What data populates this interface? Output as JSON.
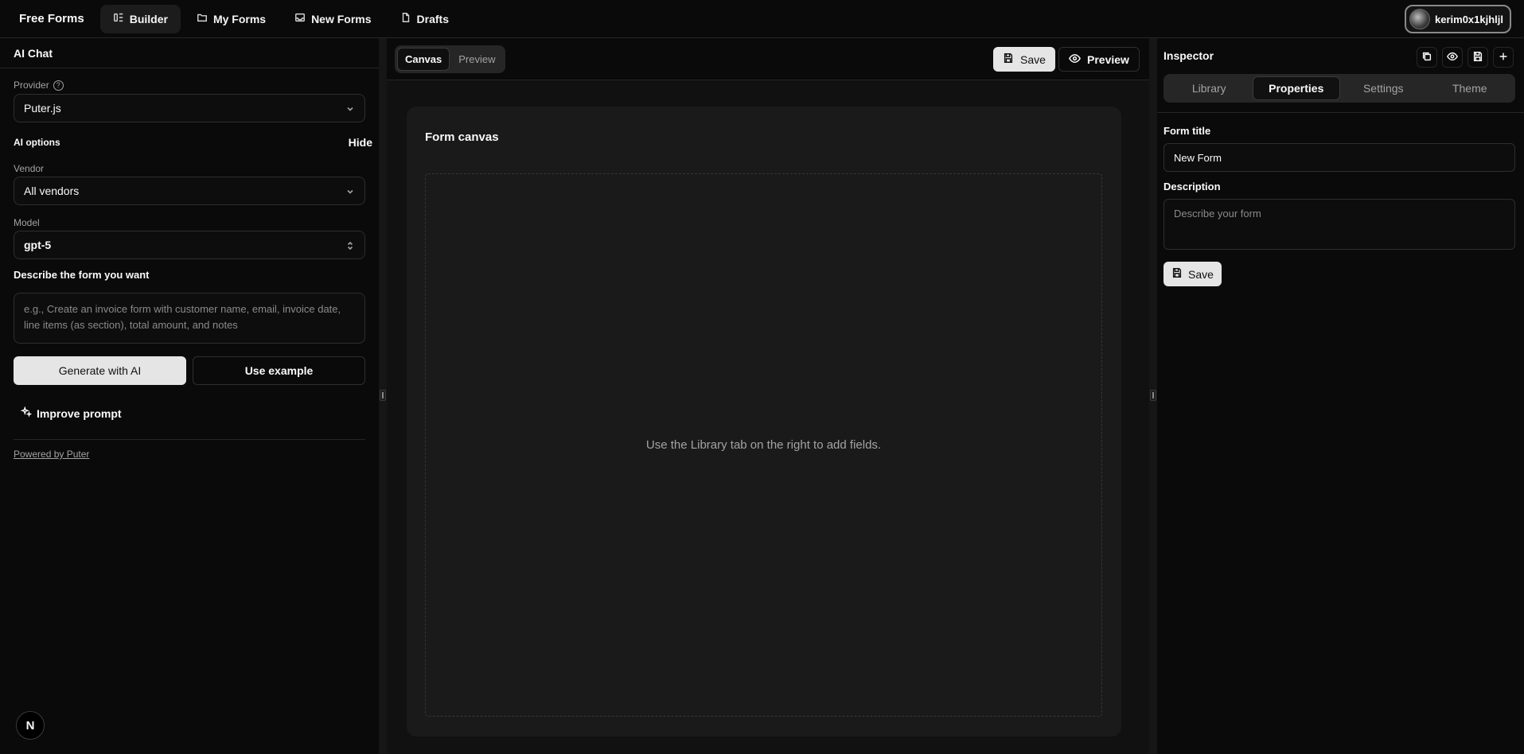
{
  "nav": {
    "brand": "Free Forms",
    "items": [
      {
        "label": "Builder",
        "icon": "builder-icon",
        "active": true
      },
      {
        "label": "My Forms",
        "icon": "folder-icon"
      },
      {
        "label": "New Forms",
        "icon": "inbox-icon"
      },
      {
        "label": "Drafts",
        "icon": "file-icon"
      }
    ],
    "user": "kerim0x1kjhljl"
  },
  "ai_chat": {
    "title": "AI Chat",
    "provider_label": "Provider",
    "provider_value": "Puter.js",
    "options_label": "AI options",
    "hide_label": "Hide",
    "vendor_label": "Vendor",
    "vendor_value": "All vendors",
    "model_label": "Model",
    "model_value": "gpt-5",
    "describe_label": "Describe the form you want",
    "describe_placeholder": "e.g., Create an invoice form with customer name, email, invoice date, line items (as section), total amount, and notes",
    "generate_label": "Generate with AI",
    "example_label": "Use example",
    "improve_label": "Improve prompt",
    "powered_label": "Powered by Puter",
    "badge": "N"
  },
  "canvas": {
    "tabs": [
      "Canvas",
      "Preview"
    ],
    "active_tab": "Canvas",
    "save_label": "Save",
    "preview_label": "Preview",
    "title": "Form canvas",
    "empty_text": "Use the Library tab on the right to add fields."
  },
  "inspector": {
    "title": "Inspector",
    "tabs": [
      "Library",
      "Properties",
      "Settings",
      "Theme"
    ],
    "active_tab": "Properties",
    "form_title_label": "Form title",
    "form_title_value": "New Form",
    "description_label": "Description",
    "description_placeholder": "Describe your form",
    "save_label": "Save"
  },
  "colors": {
    "background": "#0a0a0a",
    "surface": "#1a1a1a",
    "border": "#262626",
    "primary_button": "#e5e5e5"
  }
}
